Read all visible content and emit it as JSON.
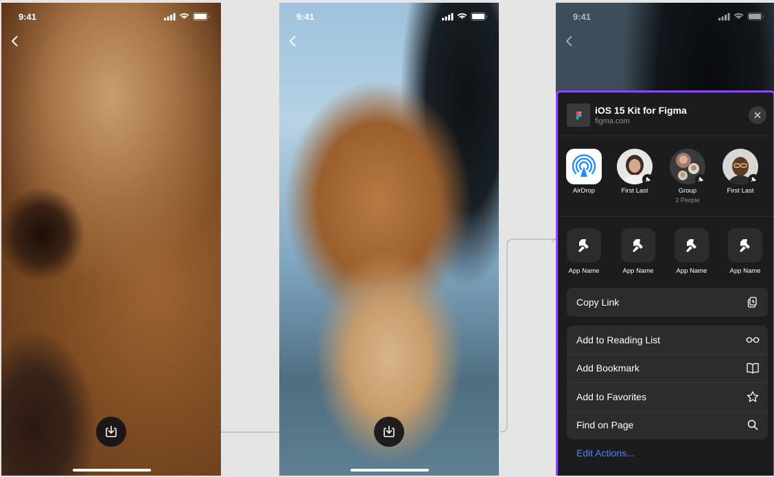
{
  "screens": [
    {
      "time": "9:41"
    },
    {
      "time": "9:41"
    },
    {
      "time": "9:41"
    }
  ],
  "share_sheet": {
    "title": "iOS 15 Kit for Figma",
    "subtitle": "figma.com",
    "contacts": [
      {
        "label": "AirDrop",
        "sub": "",
        "icon": "airdrop-icon"
      },
      {
        "label": "First Last",
        "sub": ""
      },
      {
        "label": "Group",
        "sub": "2 People"
      },
      {
        "label": "First Last",
        "sub": ""
      }
    ],
    "apps": [
      {
        "label": "App Name",
        "icon": "app-placeholder-icon"
      },
      {
        "label": "App Name",
        "icon": "app-placeholder-icon"
      },
      {
        "label": "App Name",
        "icon": "app-placeholder-icon"
      },
      {
        "label": "App Name",
        "icon": "app-placeholder-icon"
      }
    ],
    "copy_link": {
      "label": "Copy Link",
      "icon": "copy-icon"
    },
    "actions": [
      {
        "label": "Add to Reading List",
        "icon": "glasses-icon"
      },
      {
        "label": "Add Bookmark",
        "icon": "book-icon"
      },
      {
        "label": "Add to Favorites",
        "icon": "star-icon"
      },
      {
        "label": "Find on Page",
        "icon": "search-icon"
      }
    ],
    "edit_actions": "Edit Actions..."
  },
  "colors": {
    "sheet_bg": "#1c1c1e",
    "sheet_row_bg": "#2c2c2e",
    "selection_border": "#8a4bf0",
    "link_blue": "#4a86f7"
  }
}
